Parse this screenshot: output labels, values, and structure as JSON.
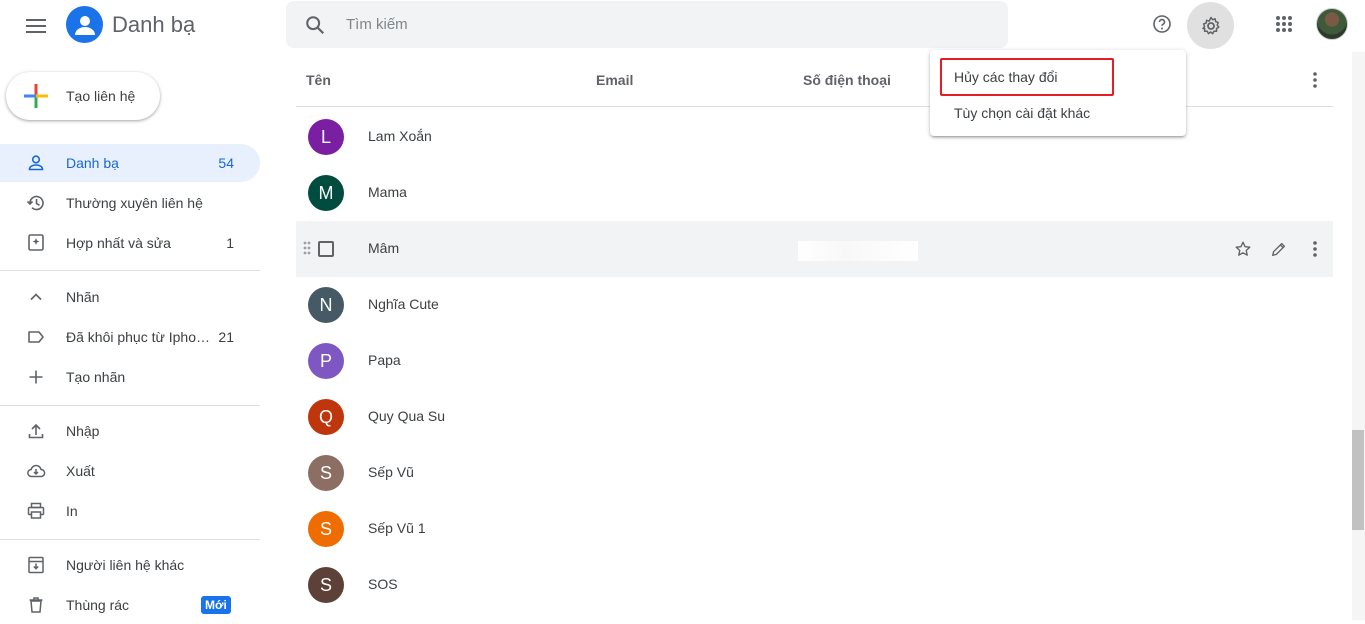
{
  "app": {
    "title": "Danh bạ"
  },
  "search": {
    "placeholder": "Tìm kiếm"
  },
  "sidebar": {
    "create_label": "Tạo liên hệ",
    "items": [
      {
        "label": "Danh bạ",
        "count": "54",
        "icon": "person-icon",
        "active": true
      },
      {
        "label": "Thường xuyên liên hệ",
        "count": "",
        "icon": "history-icon"
      },
      {
        "label": "Hợp nhất và sửa",
        "count": "1",
        "icon": "merge-icon"
      },
      {
        "label": "Nhãn",
        "count": "",
        "icon": "chevron-up-icon"
      },
      {
        "label": "Đã khôi phục từ Ipho…",
        "count": "21",
        "icon": "label-icon"
      },
      {
        "label": "Tạo nhãn",
        "count": "",
        "icon": "add-icon"
      },
      {
        "label": "Nhập",
        "count": "",
        "icon": "upload-icon"
      },
      {
        "label": "Xuất",
        "count": "",
        "icon": "cloud-download-icon"
      },
      {
        "label": "In",
        "count": "",
        "icon": "print-icon"
      },
      {
        "label": "Người liên hệ khác",
        "count": "",
        "icon": "archive-icon"
      },
      {
        "label": "Thùng rác",
        "badge": "Mới",
        "icon": "trash-icon"
      }
    ]
  },
  "table": {
    "columns": [
      "Tên",
      "Email",
      "Số điện thoại"
    ],
    "rows": [
      {
        "initial": "L",
        "name": "Lam Xoắn",
        "color": "#7b1fa2"
      },
      {
        "initial": "M",
        "name": "Mama",
        "color": "#004d40"
      },
      {
        "initial": "",
        "name": "Mâm",
        "color": ""
      },
      {
        "initial": "N",
        "name": "Nghĩa Cute",
        "color": "#455a64"
      },
      {
        "initial": "P",
        "name": "Papa",
        "color": "#7e57c2"
      },
      {
        "initial": "Q",
        "name": "Quy Qua Su",
        "color": "#bf360c"
      },
      {
        "initial": "S",
        "name": "Sếp Vũ",
        "color": "#8d6e63"
      },
      {
        "initial": "S",
        "name": "Sếp Vũ 1",
        "color": "#ef6c00"
      },
      {
        "initial": "S",
        "name": "SOS",
        "color": "#5d4037"
      }
    ]
  },
  "settings_menu": {
    "items": [
      "Hủy các thay đổi",
      "Tùy chọn cài đặt khác"
    ]
  },
  "colors": {
    "accent": "#1a73e8",
    "highlight": "#e31e24"
  }
}
